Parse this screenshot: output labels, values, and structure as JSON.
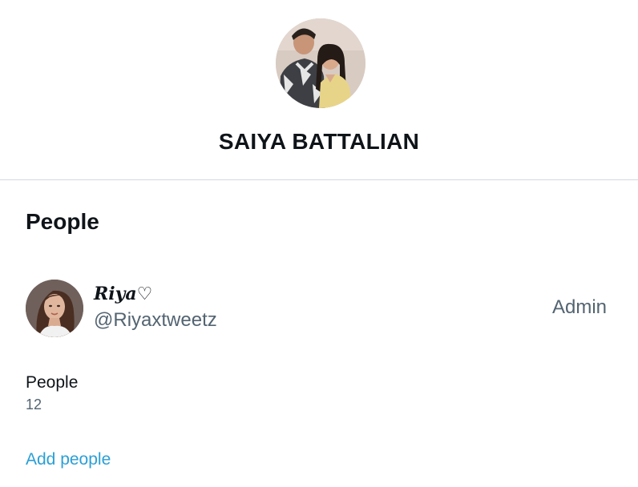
{
  "group": {
    "title": "SAIYA BATTALIAN",
    "avatar_icon": "group-photo"
  },
  "people_section": {
    "heading": "People",
    "members": [
      {
        "display_name": "Riya♡",
        "handle": "@Riyaxtweetz",
        "role": "Admin",
        "avatar_icon": "user-avatar"
      }
    ]
  },
  "summary": {
    "label": "People",
    "count": "12"
  },
  "actions": {
    "add_people_label": "Add people"
  },
  "colors": {
    "primary_text": "#0f1419",
    "secondary_text": "#536471",
    "link": "#2a9fd6",
    "divider": "#cfd9de"
  }
}
